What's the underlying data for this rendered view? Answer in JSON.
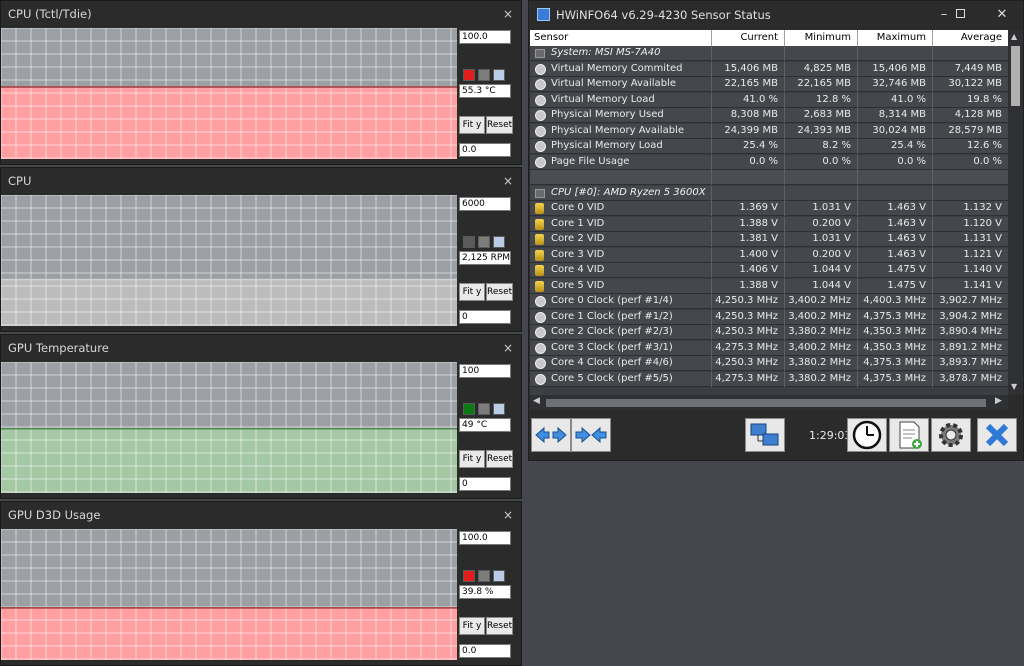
{
  "graphs": [
    {
      "title": "CPU (Tctl/Tdie)",
      "max": "100.0",
      "current": "55.3 °C",
      "min": "0.0",
      "swatch": "#e11d1d",
      "fill": "#ff9fa2",
      "line": "#a43a3a",
      "fit_label": "Fit y",
      "reset_label": "Reset",
      "level": 0.55
    },
    {
      "title": "CPU",
      "max": "6000",
      "current": "2,125 RPM",
      "min": "0",
      "swatch": "#5a5a5a",
      "fill": "#bcbcbc",
      "line": "#d3d3d3",
      "fit_label": "Fit y",
      "reset_label": "Reset",
      "level": 0.354
    },
    {
      "title": "GPU Temperature",
      "max": "100",
      "current": "49 °C",
      "min": "0",
      "swatch": "#0b7a14",
      "fill": "#a4c7a4",
      "line": "#4f8a4f",
      "fit_label": "Fit y",
      "reset_label": "Reset",
      "level": 0.49
    },
    {
      "title": "GPU D3D Usage",
      "max": "100.0",
      "current": "39.8 %",
      "min": "0.0",
      "swatch": "#e11d1d",
      "fill": "#ff9fa2",
      "line": "#a43a3a",
      "fit_label": "Fit y",
      "reset_label": "Reset",
      "level": 0.398
    }
  ],
  "close_glyph": "×",
  "hwinfo": {
    "title": "HWiNFO64 v6.29-4230 Sensor Status",
    "columns": [
      "Sensor",
      "Current",
      "Minimum",
      "Maximum",
      "Average"
    ],
    "rows": [
      {
        "type": "group",
        "name": "System: MSI MS-7A40",
        "icon": "group-icon"
      },
      {
        "type": "sensor",
        "icon": "memory-sensor-icon",
        "name": "Virtual Memory Commited",
        "cur": "15,406 MB",
        "min": "4,825 MB",
        "max": "15,406 MB",
        "avg": "7,449 MB"
      },
      {
        "type": "sensor",
        "icon": "memory-sensor-icon",
        "name": "Virtual Memory Available",
        "cur": "22,165 MB",
        "min": "22,165 MB",
        "max": "32,746 MB",
        "avg": "30,122 MB"
      },
      {
        "type": "sensor",
        "icon": "memory-sensor-icon",
        "name": "Virtual Memory Load",
        "cur": "41.0 %",
        "min": "12.8 %",
        "max": "41.0 %",
        "avg": "19.8 %"
      },
      {
        "type": "sensor",
        "icon": "memory-sensor-icon",
        "name": "Physical Memory Used",
        "cur": "8,308 MB",
        "min": "2,683 MB",
        "max": "8,314 MB",
        "avg": "4,128 MB"
      },
      {
        "type": "sensor",
        "icon": "memory-sensor-icon",
        "name": "Physical Memory Available",
        "cur": "24,399 MB",
        "min": "24,393 MB",
        "max": "30,024 MB",
        "avg": "28,579 MB"
      },
      {
        "type": "sensor",
        "icon": "memory-sensor-icon",
        "name": "Physical Memory Load",
        "cur": "25.4 %",
        "min": "8.2 %",
        "max": "25.4 %",
        "avg": "12.6 %"
      },
      {
        "type": "sensor",
        "icon": "memory-sensor-icon",
        "name": "Page File Usage",
        "cur": "0.0 %",
        "min": "0.0 %",
        "max": "0.0 %",
        "avg": "0.0 %"
      },
      {
        "type": "blank"
      },
      {
        "type": "group",
        "name": "CPU [#0]: AMD Ryzen 5 3600X",
        "icon": "group-icon"
      },
      {
        "type": "sensor",
        "icon": "voltage-sensor-icon",
        "name": "Core 0 VID",
        "cur": "1.369 V",
        "min": "1.031 V",
        "max": "1.463 V",
        "avg": "1.132 V"
      },
      {
        "type": "sensor",
        "icon": "voltage-sensor-icon",
        "name": "Core 1 VID",
        "cur": "1.388 V",
        "min": "0.200 V",
        "max": "1.463 V",
        "avg": "1.120 V"
      },
      {
        "type": "sensor",
        "icon": "voltage-sensor-icon",
        "name": "Core 2 VID",
        "cur": "1.381 V",
        "min": "1.031 V",
        "max": "1.463 V",
        "avg": "1.131 V"
      },
      {
        "type": "sensor",
        "icon": "voltage-sensor-icon",
        "name": "Core 3 VID",
        "cur": "1.400 V",
        "min": "0.200 V",
        "max": "1.463 V",
        "avg": "1.121 V"
      },
      {
        "type": "sensor",
        "icon": "voltage-sensor-icon",
        "name": "Core 4 VID",
        "cur": "1.406 V",
        "min": "1.044 V",
        "max": "1.475 V",
        "avg": "1.140 V"
      },
      {
        "type": "sensor",
        "icon": "voltage-sensor-icon",
        "name": "Core 5 VID",
        "cur": "1.388 V",
        "min": "1.044 V",
        "max": "1.475 V",
        "avg": "1.141 V"
      },
      {
        "type": "sensor",
        "icon": "memory-sensor-icon",
        "name": "Core 0 Clock (perf #1/4)",
        "cur": "4,250.3 MHz",
        "min": "3,400.2 MHz",
        "max": "4,400.3 MHz",
        "avg": "3,902.7 MHz"
      },
      {
        "type": "sensor",
        "icon": "memory-sensor-icon",
        "name": "Core 1 Clock (perf #1/2)",
        "cur": "4,250.3 MHz",
        "min": "3,400.2 MHz",
        "max": "4,375.3 MHz",
        "avg": "3,904.2 MHz"
      },
      {
        "type": "sensor",
        "icon": "memory-sensor-icon",
        "name": "Core 2 Clock (perf #2/3)",
        "cur": "4,250.3 MHz",
        "min": "3,380.2 MHz",
        "max": "4,350.3 MHz",
        "avg": "3,890.4 MHz"
      },
      {
        "type": "sensor",
        "icon": "memory-sensor-icon",
        "name": "Core 3 Clock (perf #3/1)",
        "cur": "4,275.3 MHz",
        "min": "3,400.2 MHz",
        "max": "4,350.3 MHz",
        "avg": "3,891.2 MHz"
      },
      {
        "type": "sensor",
        "icon": "memory-sensor-icon",
        "name": "Core 4 Clock (perf #4/6)",
        "cur": "4,250.3 MHz",
        "min": "3,380.2 MHz",
        "max": "4,375.3 MHz",
        "avg": "3,893.7 MHz"
      },
      {
        "type": "sensor",
        "icon": "memory-sensor-icon",
        "name": "Core 5 Clock (perf #5/5)",
        "cur": "4,275.3 MHz",
        "min": "3,380.2 MHz",
        "max": "4,375.3 MHz",
        "avg": "3,878.7 MHz"
      }
    ],
    "elapsed": "1:29:03",
    "toolbar_icons": [
      "expand-arrows-icon",
      "collapse-arrows-icon",
      "network-icon",
      "clock-icon",
      "report-add-icon",
      "settings-gear-icon",
      "close-x-icon"
    ]
  }
}
